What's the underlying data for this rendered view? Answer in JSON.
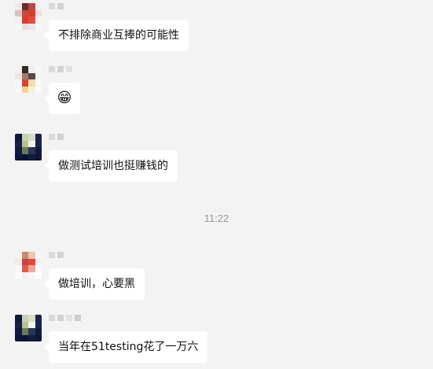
{
  "conversation": {
    "messages": [
      {
        "text": "不排除商业互捧的可能性"
      },
      {
        "text": "😁"
      },
      {
        "text": "做测试培训也挺赚钱的"
      },
      {
        "text": "做培训，心要黑"
      },
      {
        "text": "当年在51testing花了一万六"
      }
    ],
    "timestamp": "11:22"
  }
}
